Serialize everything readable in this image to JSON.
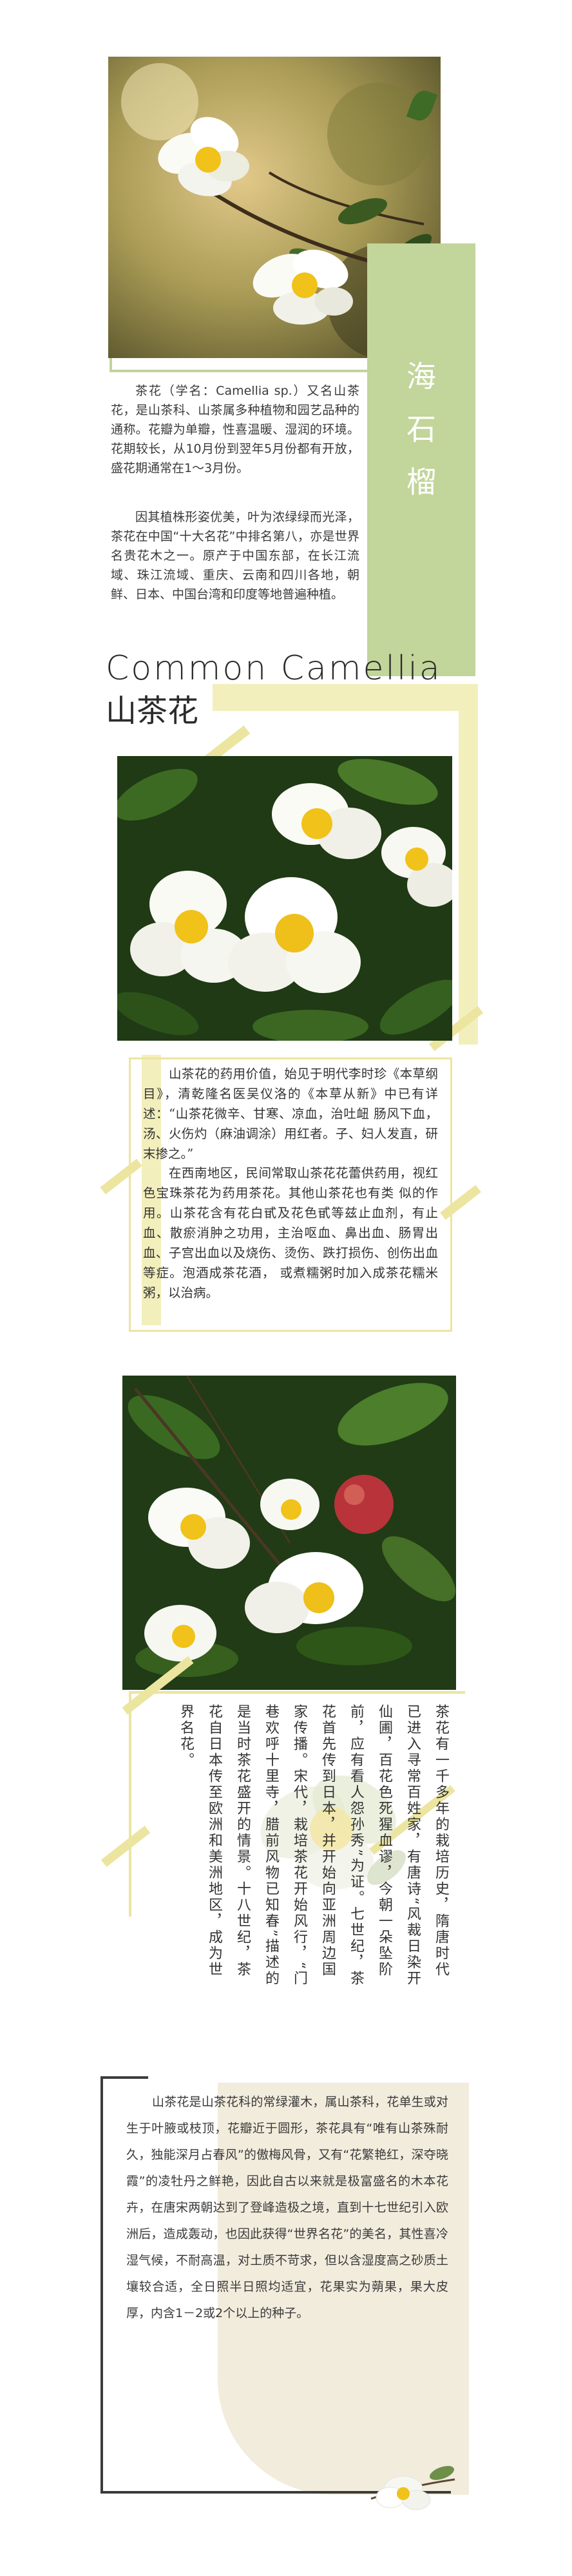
{
  "colors": {
    "green": "#c2d59a",
    "green_light": "#dbe6bf",
    "yellow_light": "#f3efbd",
    "yellow": "#ece5a0",
    "frame_dark": "#3c3c3c",
    "beige": "#e9dfc6"
  },
  "section1": {
    "vertical_title": "海石榴",
    "para1": "茶花（学名：Camellia sp.）又名山茶花，是山茶科、山茶属多种植物和园艺品种的通称。花瓣为单瓣，性喜温暖、湿润的环境。花期较长，从10月份到翌年5月份都有开放，盛花期通常在1～3月份。",
    "para2": "因其植株形姿优美，叶为浓绿绿而光泽，茶花在中国“十大名花”中排名第八，亦是世界名贵花木之一。原产于中国东部，在长江流域、珠江流域、重庆、云南和四川各地，朝鲜、日本、中国台湾和印度等地普遍种植。"
  },
  "heading": {
    "en": "Common Camellia",
    "cn": "山茶花"
  },
  "section2": {
    "para1": "山茶花的药用价值，始见于明代李时珍《本草纲目》，清乾隆名医吴仪洛的《本草从新》中已有详述：“山茶花微辛、甘寒、凉血，治吐衄 肠风下血，汤、火伤灼（麻油调涂）用红者。子、妇人发直，研末掺之。”",
    "para2": "在西南地区，民间常取山茶花花蕾供药用，视红色宝珠茶花为药用茶花。其他山茶花也有类 似的作用。山茶花含有花白甙及花色甙等兹止血剂，有止血、散瘀消肿之功用，主治呕血、鼻出血、肠胃出血、子宫出血以及烧伤、烫伤、跌打损伤、创伤出血等症。泡酒成茶花酒， 或煮糯粥时加入成茶花糯米粥，以治病。"
  },
  "section3": {
    "vertical": "茶花有一千多年的栽培历史，隋唐时代已进入寻常百姓家，有唐诗“风裁日染开仙圃，百花色死猩血谬，今朝一朵坠阶前，应有看人怨孙秀”为证。七世纪，茶花首先传到日本，并开始向亚洲周边国家传播。宋代，栽培茶花开始风行，“门巷欢呼十里寺，腊前风物已知春”描述的是当时茶花盛开的情景。十八世纪，茶花自日本传至欧洲和美洲地区，成为世界名花。"
  },
  "section4": {
    "para": "山茶花是山茶花科的常绿灌木，属山茶科，花单生或对生于叶腋或枝顶，花瓣近于圆形，茶花具有“唯有山茶殊耐久，独能深月占春风”的傲梅风骨，又有“花繁艳红，深夺晓霞”的凌牡丹之鲜艳，因此自古以来就是极富盛名的木本花卉，在唐宋两朝达到了登峰造极之境，直到十七世纪引入欧洲后，造成轰动，也因此获得“世界名花”的美名，其性喜冷湿气候，不耐高温，对土质不苛求，但以含湿度高之砂质土壤较合适，全日照半日照均适宜，花果实为蒴果，果大皮厚，内含1－2或2个以上的种子。"
  }
}
